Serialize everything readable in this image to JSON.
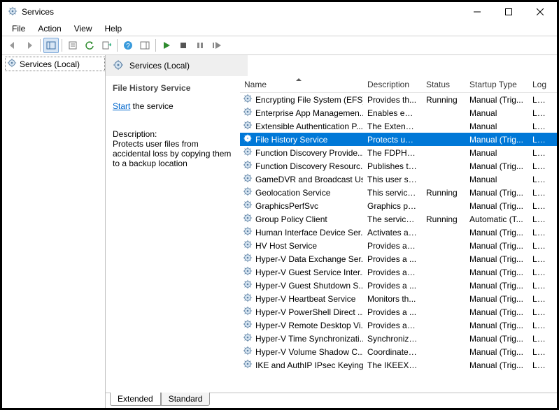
{
  "window": {
    "title": "Services"
  },
  "menu": {
    "file": "File",
    "action": "Action",
    "view": "View",
    "help": "Help"
  },
  "tree": {
    "root": "Services (Local)"
  },
  "header": {
    "title": "Services (Local)"
  },
  "detail": {
    "service_name": "File History Service",
    "start_link": "Start",
    "start_rest": " the service",
    "desc_label": "Description:",
    "desc_text": "Protects user files from accidental loss by copying them to a backup location"
  },
  "columns": {
    "name": "Name",
    "desc": "Description",
    "status": "Status",
    "startup": "Startup Type",
    "logon": "Log"
  },
  "tabs": {
    "extended": "Extended",
    "standard": "Standard"
  },
  "rows": [
    {
      "name": "Encrypting File System (EFS)",
      "desc": "Provides th...",
      "status": "Running",
      "startup": "Manual (Trig...",
      "logon": "Loca",
      "selected": false
    },
    {
      "name": "Enterprise App Managemen...",
      "desc": "Enables ent...",
      "status": "",
      "startup": "Manual",
      "logon": "Loca",
      "selected": false
    },
    {
      "name": "Extensible Authentication P...",
      "desc": "The Extensi...",
      "status": "",
      "startup": "Manual",
      "logon": "Loca",
      "selected": false
    },
    {
      "name": "File History Service",
      "desc": "Protects use...",
      "status": "",
      "startup": "Manual (Trig...",
      "logon": "Loca",
      "selected": true
    },
    {
      "name": "Function Discovery Provide...",
      "desc": "The FDPHO...",
      "status": "",
      "startup": "Manual",
      "logon": "Loca",
      "selected": false
    },
    {
      "name": "Function Discovery Resourc...",
      "desc": "Publishes th...",
      "status": "",
      "startup": "Manual (Trig...",
      "logon": "Loca",
      "selected": false
    },
    {
      "name": "GameDVR and Broadcast Us...",
      "desc": "This user ser...",
      "status": "",
      "startup": "Manual",
      "logon": "Loca",
      "selected": false
    },
    {
      "name": "Geolocation Service",
      "desc": "This service ...",
      "status": "Running",
      "startup": "Manual (Trig...",
      "logon": "Loca",
      "selected": false
    },
    {
      "name": "GraphicsPerfSvc",
      "desc": "Graphics pe...",
      "status": "",
      "startup": "Manual (Trig...",
      "logon": "Loca",
      "selected": false
    },
    {
      "name": "Group Policy Client",
      "desc": "The service i...",
      "status": "Running",
      "startup": "Automatic (T...",
      "logon": "Loca",
      "selected": false
    },
    {
      "name": "Human Interface Device Ser...",
      "desc": "Activates an...",
      "status": "",
      "startup": "Manual (Trig...",
      "logon": "Loca",
      "selected": false
    },
    {
      "name": "HV Host Service",
      "desc": "Provides an ...",
      "status": "",
      "startup": "Manual (Trig...",
      "logon": "Loca",
      "selected": false
    },
    {
      "name": "Hyper-V Data Exchange Ser...",
      "desc": "Provides a ...",
      "status": "",
      "startup": "Manual (Trig...",
      "logon": "Loca",
      "selected": false
    },
    {
      "name": "Hyper-V Guest Service Inter...",
      "desc": "Provides an ...",
      "status": "",
      "startup": "Manual (Trig...",
      "logon": "Loca",
      "selected": false
    },
    {
      "name": "Hyper-V Guest Shutdown S...",
      "desc": "Provides a ...",
      "status": "",
      "startup": "Manual (Trig...",
      "logon": "Loca",
      "selected": false
    },
    {
      "name": "Hyper-V Heartbeat Service",
      "desc": "Monitors th...",
      "status": "",
      "startup": "Manual (Trig...",
      "logon": "Loca",
      "selected": false
    },
    {
      "name": "Hyper-V PowerShell Direct ...",
      "desc": "Provides a ...",
      "status": "",
      "startup": "Manual (Trig...",
      "logon": "Loca",
      "selected": false
    },
    {
      "name": "Hyper-V Remote Desktop Vi...",
      "desc": "Provides a p...",
      "status": "",
      "startup": "Manual (Trig...",
      "logon": "Loca",
      "selected": false
    },
    {
      "name": "Hyper-V Time Synchronizati...",
      "desc": "Synchronize...",
      "status": "",
      "startup": "Manual (Trig...",
      "logon": "Loca",
      "selected": false
    },
    {
      "name": "Hyper-V Volume Shadow C...",
      "desc": "Coordinates...",
      "status": "",
      "startup": "Manual (Trig...",
      "logon": "Loca",
      "selected": false
    },
    {
      "name": "IKE and AuthIP IPsec Keying...",
      "desc": "The IKEEXT ...",
      "status": "",
      "startup": "Manual (Trig...",
      "logon": "Loca",
      "selected": false
    }
  ]
}
